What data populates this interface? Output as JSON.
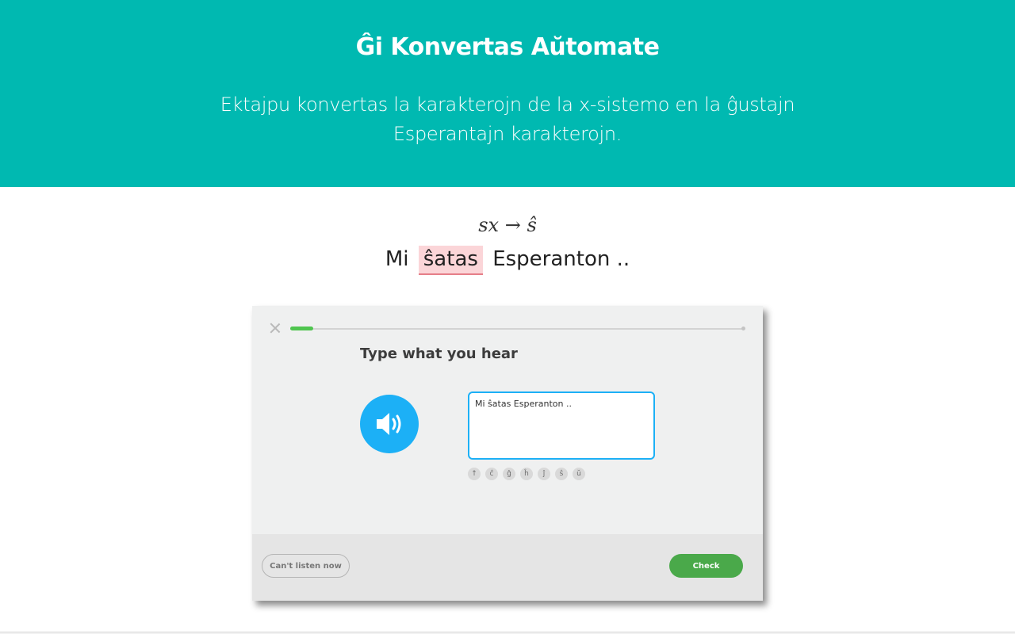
{
  "hero": {
    "title": "Ĝi Konvertas Aŭtomate",
    "subtitle": "Ektajpu konvertas la karakterojn de la x-sistemo en la ĝustajn Esperantajn karakterojn."
  },
  "demo": {
    "formula": "sx → ŝ",
    "example_before": "Mi",
    "example_highlight": "ŝatas",
    "example_after": "Esperanton .."
  },
  "lesson": {
    "progress_fraction": 0.05,
    "prompt": "Type what you hear",
    "answer_value": "Mi ŝatas Esperanton ..",
    "special_keys": [
      "↑",
      "ĉ",
      "ĝ",
      "ĥ",
      "ĵ",
      "ŝ",
      "ŭ"
    ],
    "cant_listen_label": "Can't listen now",
    "check_label": "Check"
  },
  "colors": {
    "hero_bg": "#00b9b1",
    "highlight_bg": "#fbd5d8",
    "speaker_bg": "#1cb0f6",
    "check_bg": "#4aa94a",
    "progress_fill": "#4fc54f"
  },
  "icons": {
    "close": "close-icon",
    "speaker": "speaker-icon"
  }
}
